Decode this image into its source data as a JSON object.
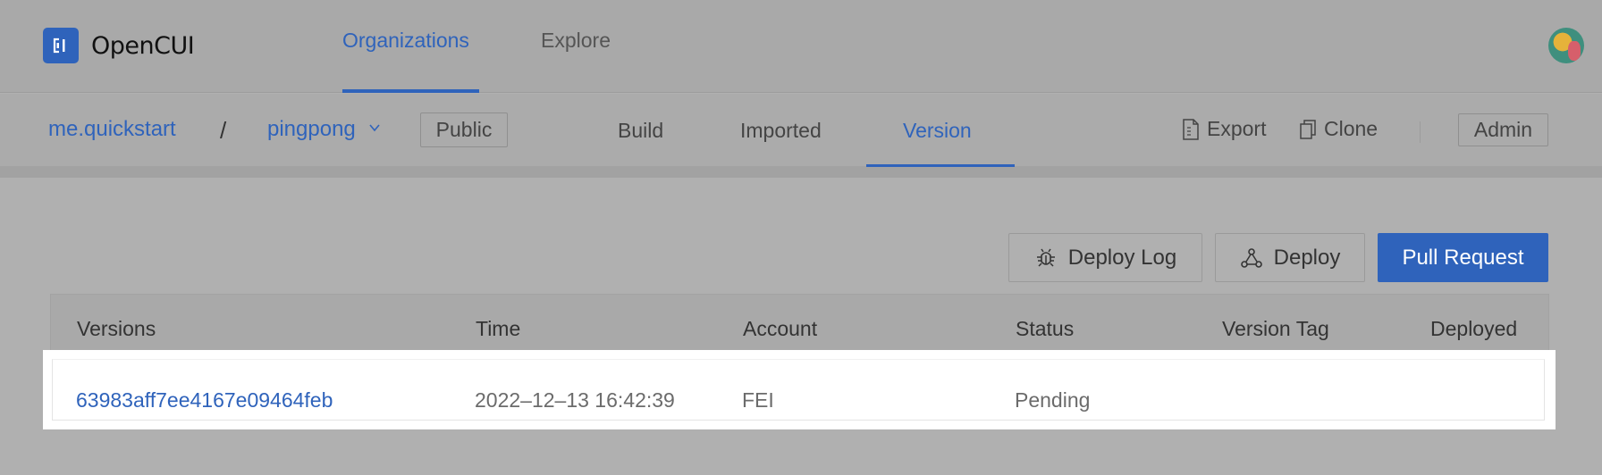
{
  "app": {
    "name": "OpenCUI"
  },
  "topnav": {
    "tabs": [
      {
        "label": "Organizations",
        "active": true
      },
      {
        "label": "Explore",
        "active": false
      }
    ]
  },
  "subheader": {
    "org": "me.quickstart",
    "separator": "/",
    "project": "pingpong",
    "visibility": "Public",
    "tabs": [
      {
        "label": "Build",
        "active": false
      },
      {
        "label": "Imported",
        "active": false
      },
      {
        "label": "Version",
        "active": true
      }
    ],
    "actions": {
      "export": "Export",
      "clone": "Clone",
      "admin": "Admin"
    }
  },
  "toolbar": {
    "deploy_log": "Deploy Log",
    "deploy": "Deploy",
    "pull_request": "Pull Request"
  },
  "table": {
    "columns": [
      "Versions",
      "Time",
      "Account",
      "Status",
      "Version Tag",
      "Deployed"
    ],
    "rows": [
      {
        "version": "63983aff7ee4167e09464feb",
        "time": "2022–12–13 16:42:39",
        "account": "FEI",
        "status": "Pending",
        "tag": "",
        "deployed": ""
      }
    ]
  },
  "colors": {
    "accent": "#2f63bb",
    "overlay": "#b0b0b0"
  }
}
